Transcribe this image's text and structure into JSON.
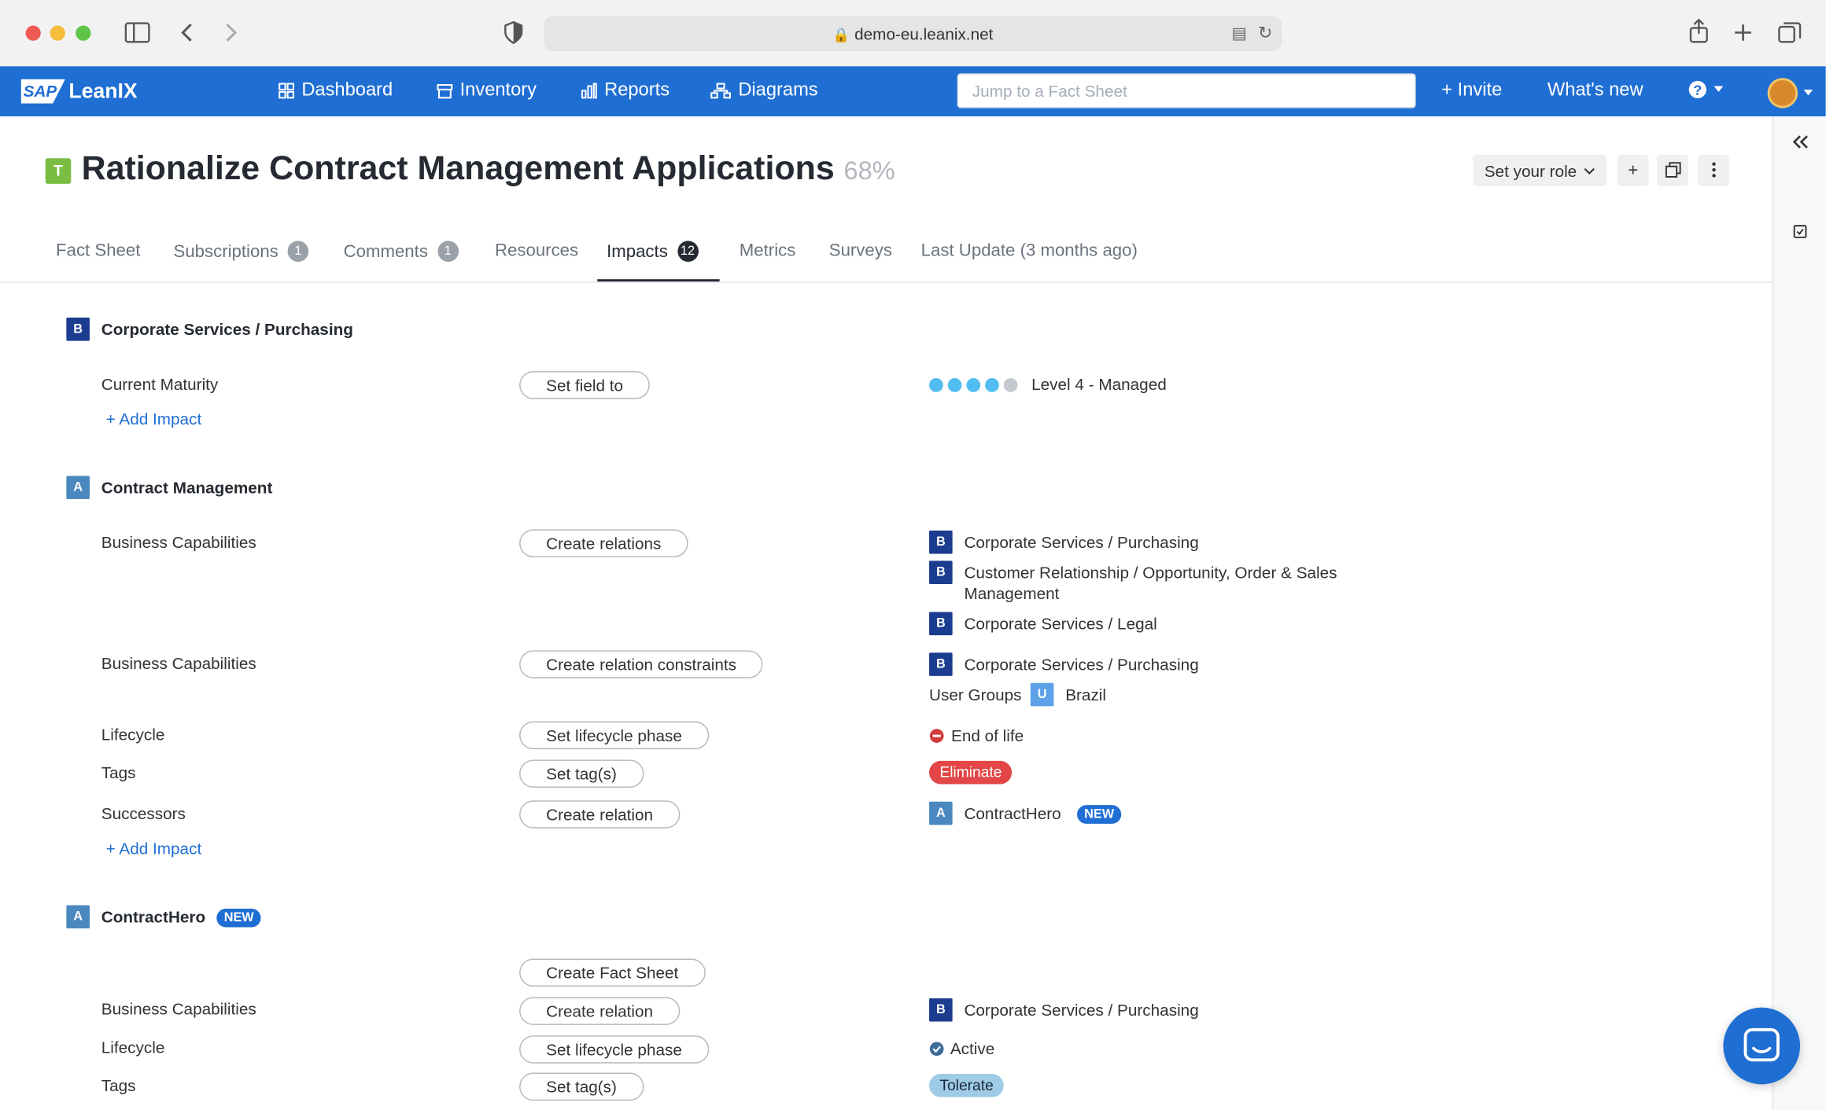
{
  "browser": {
    "url": "demo-eu.leanix.net"
  },
  "nav": {
    "logo_sap": "SAP",
    "logo_lx": "LeanIX",
    "items": [
      "Dashboard",
      "Inventory",
      "Reports",
      "Diagrams"
    ],
    "search_placeholder": "Jump to a Fact Sheet",
    "invite": "+ Invite",
    "whats_new": "What's new"
  },
  "header": {
    "type_badge": "T",
    "title": "Rationalize Contract Management Applications",
    "percent": "68%",
    "role": "Set your role"
  },
  "tabs": [
    {
      "label": "Fact Sheet",
      "count": ""
    },
    {
      "label": "Subscriptions",
      "count": "1"
    },
    {
      "label": "Comments",
      "count": "1"
    },
    {
      "label": "Resources",
      "count": ""
    },
    {
      "label": "Impacts",
      "count": "12"
    },
    {
      "label": "Metrics",
      "count": ""
    },
    {
      "label": "Surveys",
      "count": ""
    },
    {
      "label": "Last Update (3 months ago)",
      "count": ""
    }
  ],
  "sections": [
    {
      "badge": "B",
      "title": "Corporate Services / Purchasing",
      "rows": [
        {
          "label": "Current Maturity",
          "action": "Set field to",
          "value": "Level 4 - Managed",
          "maturity_level": 4,
          "maturity_max": 5
        }
      ],
      "add": "+ Add Impact"
    },
    {
      "badge": "A",
      "title": "Contract Management",
      "rows": [
        {
          "label": "Business Capabilities",
          "action": "Create relations",
          "values": [
            {
              "badge": "B",
              "text": "Corporate Services / Purchasing"
            },
            {
              "badge": "B",
              "text": "Customer Relationship / Opportunity, Order & Sales Management"
            },
            {
              "badge": "B",
              "text": "Corporate Services / Legal"
            }
          ]
        },
        {
          "label": "Business Capabilities",
          "action": "Create relation constraints",
          "values": [
            {
              "badge": "B",
              "text": "Corporate Services / Purchasing"
            },
            {
              "prefix": "User Groups",
              "badge": "U",
              "text": "Brazil"
            }
          ]
        },
        {
          "label": "Lifecycle",
          "action": "Set lifecycle phase",
          "value": "End of life"
        },
        {
          "label": "Tags",
          "action": "Set tag(s)",
          "tag": "Eliminate",
          "tag_color": "#e24646"
        },
        {
          "label": "Successors",
          "action": "Create relation",
          "badge": "A",
          "value": "ContractHero",
          "new": "NEW"
        }
      ],
      "add": "+ Add Impact"
    },
    {
      "badge": "A",
      "title": "ContractHero",
      "new": "NEW",
      "rows": [
        {
          "label": "",
          "action": "Create Fact Sheet"
        },
        {
          "label": "Business Capabilities",
          "action": "Create relation",
          "badge": "B",
          "value": "Corporate Services / Purchasing"
        },
        {
          "label": "Lifecycle",
          "action": "Set lifecycle phase",
          "value": "Active"
        },
        {
          "label": "Tags",
          "action": "Set tag(s)",
          "tag": "Tolerate",
          "tag_color": "#9fcbe6"
        }
      ]
    }
  ]
}
